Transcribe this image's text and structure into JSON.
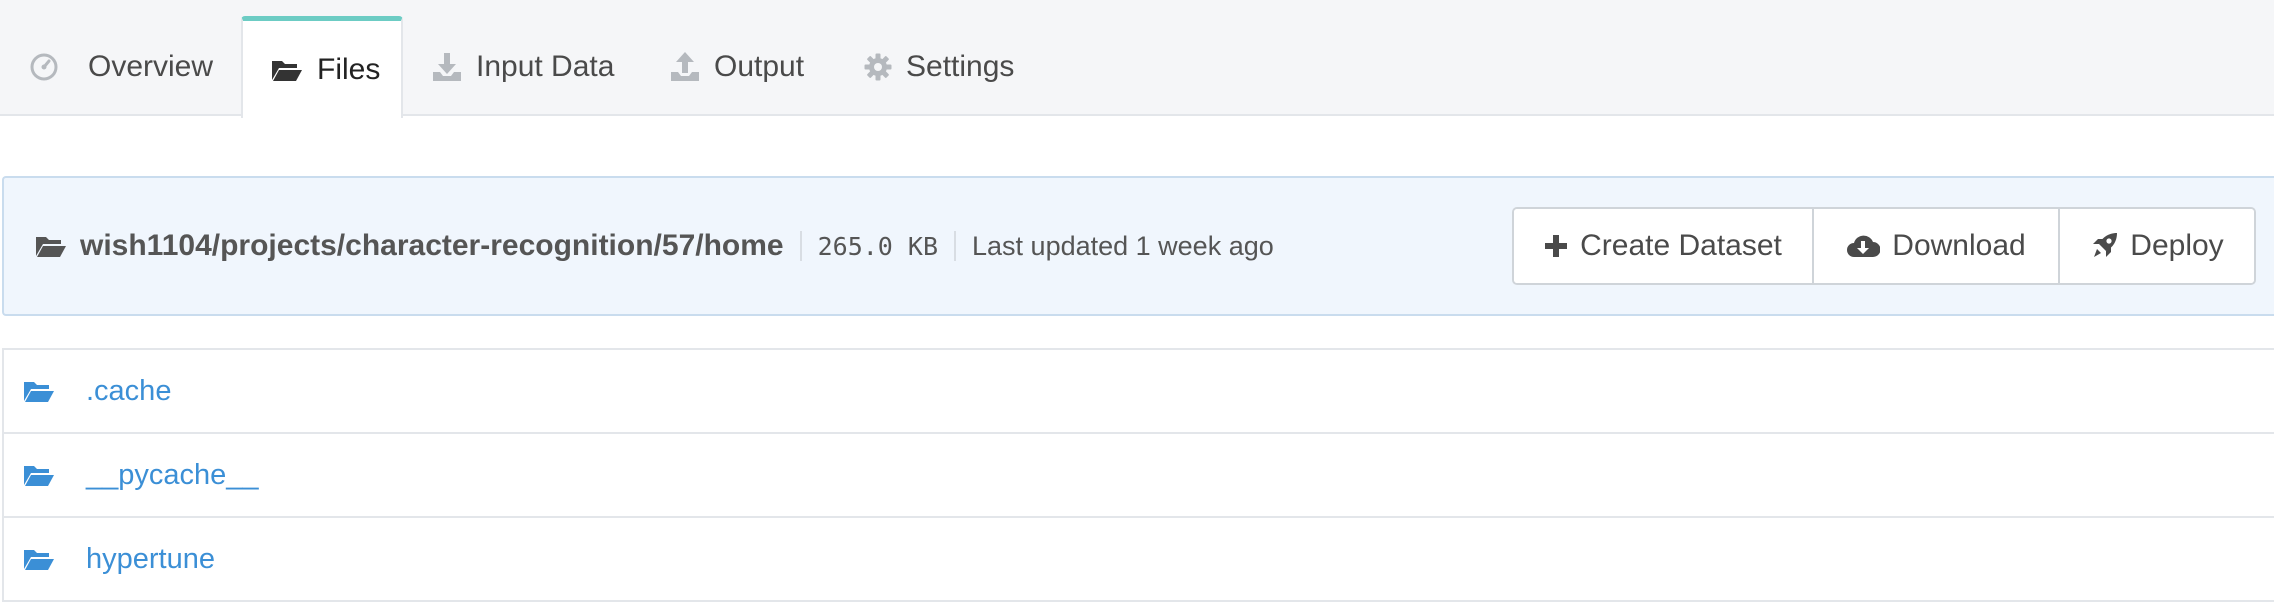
{
  "tabs": [
    {
      "label": "Overview",
      "icon": "dashboard-icon",
      "active": false
    },
    {
      "label": "Files",
      "icon": "folder-open-icon",
      "active": true
    },
    {
      "label": "Input Data",
      "icon": "download-tray-icon",
      "active": false
    },
    {
      "label": "Output",
      "icon": "upload-tray-icon",
      "active": false
    },
    {
      "label": "Settings",
      "icon": "gear-icon",
      "active": false
    }
  ],
  "pathbar": {
    "path": "wish1104/projects/character-recognition/57/home",
    "size": "265.0 KB",
    "updated": "Last updated 1 week ago"
  },
  "actions": {
    "create_dataset": "Create Dataset",
    "download": "Download",
    "deploy": "Deploy"
  },
  "files": [
    {
      "name": ".cache",
      "type": "folder"
    },
    {
      "name": "__pycache__",
      "type": "folder"
    },
    {
      "name": "hypertune",
      "type": "folder"
    }
  ],
  "colors": {
    "accent_tab": "#6cccc4",
    "link": "#3b8fd6",
    "pathbar_bg": "#f0f6fd",
    "tabbar_bg": "#f5f6f8"
  }
}
